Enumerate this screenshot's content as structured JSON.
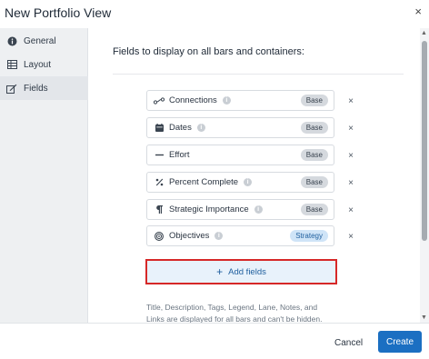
{
  "dialog": {
    "title": "New Portfolio View",
    "close_label": "×"
  },
  "sidebar": {
    "items": [
      {
        "label": "General",
        "icon": "info-circle-icon"
      },
      {
        "label": "Layout",
        "icon": "grid-icon"
      },
      {
        "label": "Fields",
        "icon": "edit-icon",
        "active": true
      }
    ]
  },
  "main": {
    "heading": "Fields to display on all bars and containers:",
    "fields": [
      {
        "name": "Connections",
        "badge": "Base",
        "icon": "connections-icon",
        "has_info": true
      },
      {
        "name": "Dates",
        "badge": "Base",
        "icon": "calendar-icon",
        "has_info": true
      },
      {
        "name": "Effort",
        "badge": "Base",
        "icon": "dash-icon",
        "has_info": false
      },
      {
        "name": "Percent Complete",
        "badge": "Base",
        "icon": "percent-icon",
        "has_info": true
      },
      {
        "name": "Strategic Importance",
        "badge": "Base",
        "icon": "paragraph-icon",
        "has_info": true
      },
      {
        "name": "Objectives",
        "badge": "Strategy",
        "icon": "target-icon",
        "has_info": true
      }
    ],
    "remove_label": "×",
    "add_fields_label": "Add fields",
    "footnote": "Title, Description, Tags, Legend, Lane, Notes, and Links are displayed for all bars and can't be hidden."
  },
  "footer": {
    "cancel_label": "Cancel",
    "create_label": "Create"
  },
  "colors": {
    "primary": "#1b6fc2",
    "highlight_border": "#d62828",
    "sidebar_bg": "#eef0f2"
  }
}
